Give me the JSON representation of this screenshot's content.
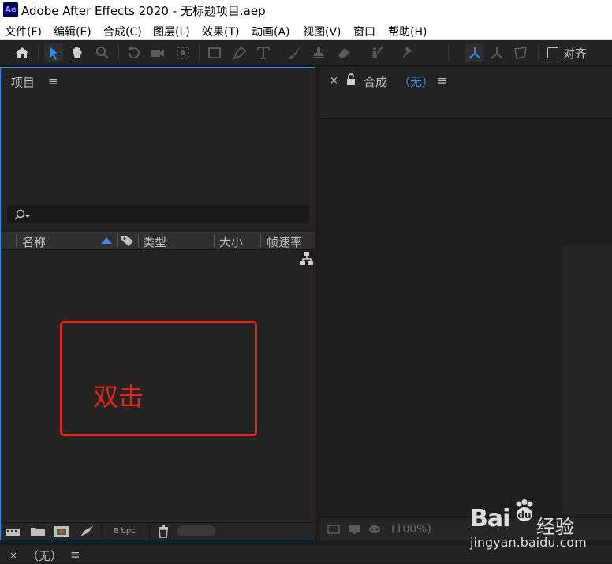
{
  "titlebar": {
    "logo_text": "Ae",
    "title": "Adobe After Effects 2020 - 无标题项目.aep"
  },
  "menubar": {
    "items": [
      "文件(F)",
      "编辑(E)",
      "合成(C)",
      "图层(L)",
      "效果(T)",
      "动画(A)",
      "视图(V)",
      "窗口",
      "帮助(H)"
    ]
  },
  "toolbar": {
    "tools": [
      "home-icon",
      "selection-tool-icon",
      "hand-tool-icon",
      "zoom-tool-icon",
      "rotate-tool-icon",
      "camera-tool-icon",
      "pan-behind-tool-icon",
      "rectangle-tool-icon",
      "pen-tool-icon",
      "text-tool-icon",
      "brush-tool-icon",
      "clone-stamp-tool-icon",
      "eraser-tool-icon",
      "roto-brush-tool-icon",
      "puppet-pin-tool-icon",
      "axis-local-icon",
      "axis-world-icon",
      "axis-view-icon"
    ],
    "align_label": "对齐",
    "align_checked": false,
    "active_color": "#2d8ceb"
  },
  "project_panel": {
    "title": "项目",
    "search_placeholder": "",
    "columns": {
      "name": "名称",
      "type": "类型",
      "size": "大小",
      "framerate": "帧速率"
    },
    "bit_depth": "8 bpc"
  },
  "annotation": {
    "text": "双击",
    "color": "#e8231e"
  },
  "composition_panel": {
    "label": "合成",
    "name": "（无）",
    "zoom": "(100%)"
  },
  "timeline": {
    "name": "（无）"
  },
  "watermark": {
    "brand": "Bai",
    "jingyan": "经验",
    "url": "jingyan.baidu.com"
  }
}
